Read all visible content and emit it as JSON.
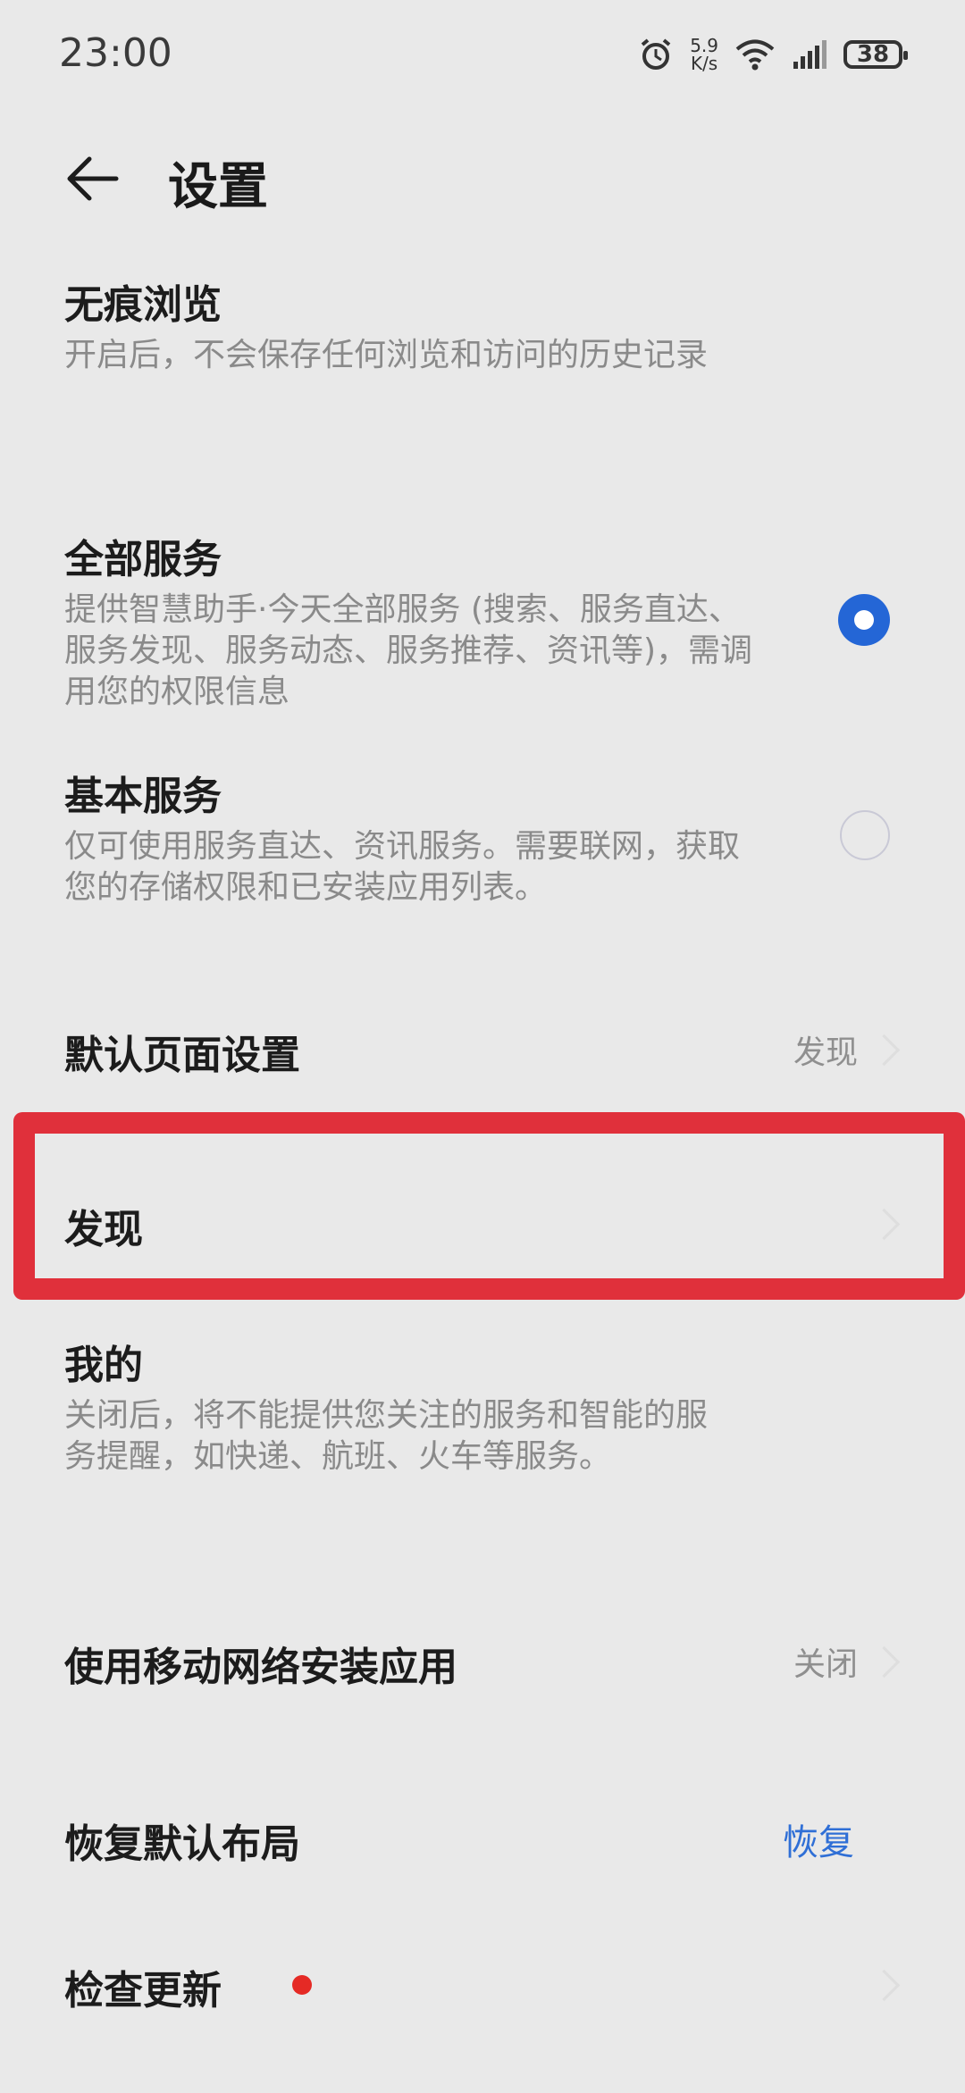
{
  "status_bar": {
    "time": "23:00",
    "speed_value": "5.9",
    "speed_unit": "K/s",
    "battery": "38"
  },
  "header": {
    "title": "设置"
  },
  "items": {
    "incognito": {
      "label": "无痕浏览",
      "desc": "开启后，不会保存任何浏览和访问的历史记录"
    },
    "full_service": {
      "label": "全部服务",
      "desc": "提供智慧助手·今天全部服务 (搜索、服务直达、服务发现、服务动态、服务推荐、资讯等)，需调用您的权限信息",
      "selected": true
    },
    "basic_service": {
      "label": "基本服务",
      "desc": "仅可使用服务直达、资讯服务。需要联网，获取您的存储权限和已安装应用列表。",
      "selected": false
    },
    "default_page": {
      "label": "默认页面设置",
      "value": "发现"
    },
    "discover": {
      "label": "发现"
    },
    "mine": {
      "label": "我的",
      "desc": "关闭后，将不能提供您关注的服务和智能的服务提醒，如快递、航班、火车等服务。"
    },
    "mobile_install": {
      "label": "使用移动网络安装应用",
      "value": "关闭"
    },
    "restore_layout": {
      "label": "恢复默认布局",
      "action": "恢复"
    },
    "check_update": {
      "label": "检查更新"
    }
  },
  "colors": {
    "background": "#e9e9e9",
    "accent": "#2466d6",
    "highlight": "#e0303b",
    "badge": "#e52a25"
  }
}
